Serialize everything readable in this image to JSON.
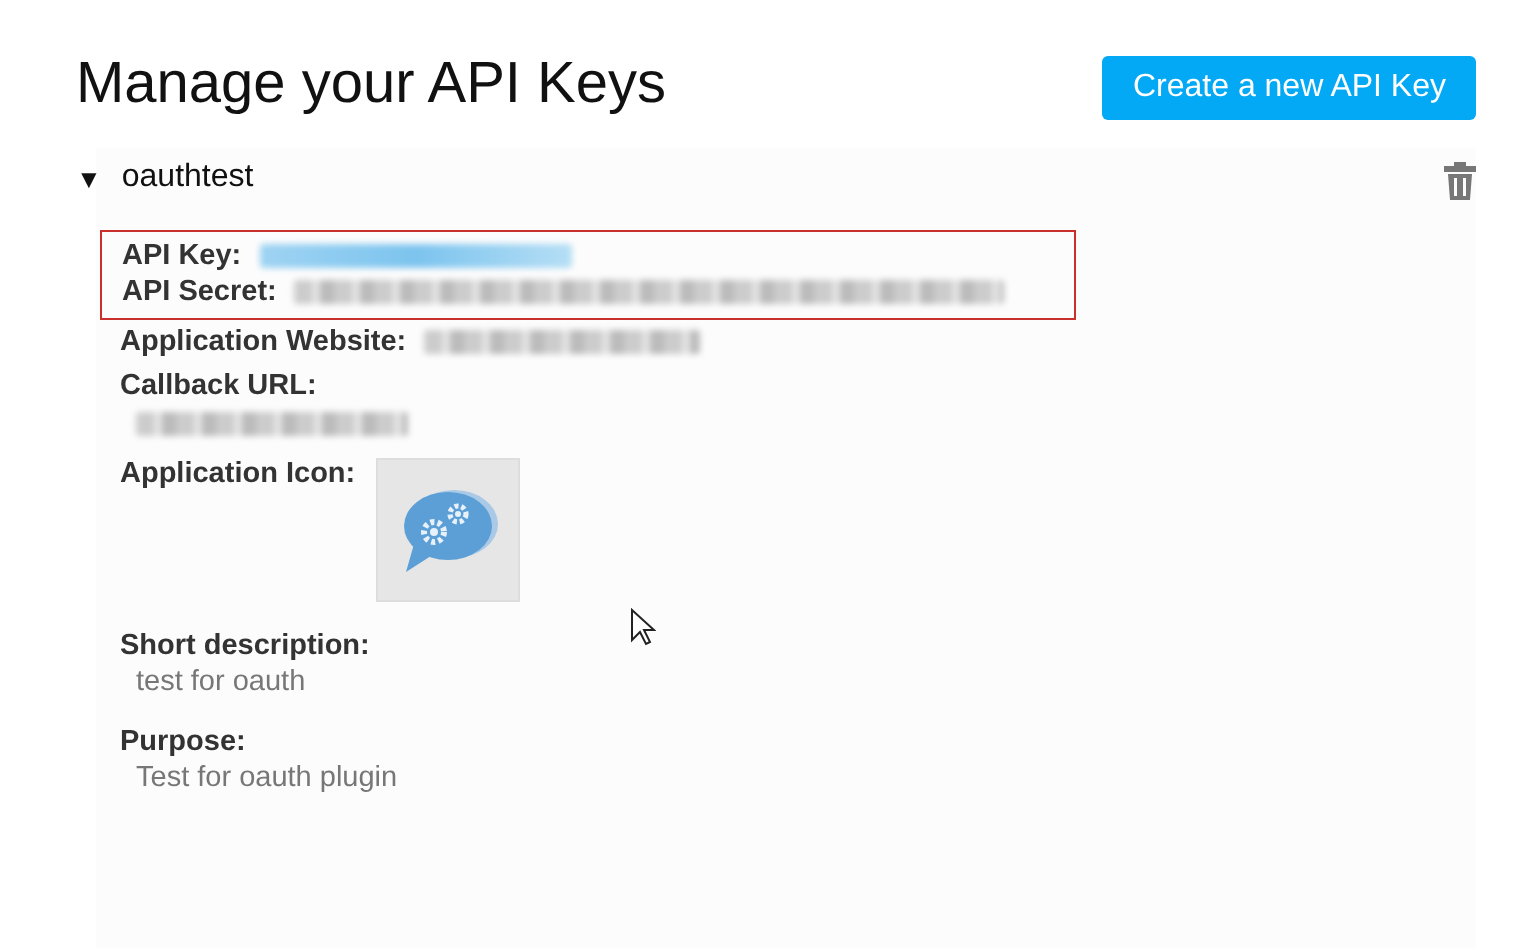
{
  "page": {
    "title": "Manage your API Keys",
    "create_button": "Create a new API Key"
  },
  "app": {
    "toggle": "▼",
    "name": "oauthtest",
    "expanded": true,
    "highlighted_fields": [
      {
        "label": "API Key:",
        "kind": "blurred_inline",
        "link": true
      },
      {
        "label": "API Secret:",
        "kind": "blurred_inline",
        "link": false
      }
    ],
    "fields": [
      {
        "label": "Application Website:",
        "kind": "blurred_inline",
        "link": false
      },
      {
        "label": "Callback URL:",
        "kind": "blurred_stacked",
        "link": false
      },
      {
        "label": "Application Icon:",
        "kind": "icon"
      },
      {
        "label": "Short description:",
        "kind": "text",
        "value": "test for oauth"
      },
      {
        "label": "Purpose:",
        "kind": "text",
        "value": "Test for oauth plugin"
      }
    ]
  }
}
